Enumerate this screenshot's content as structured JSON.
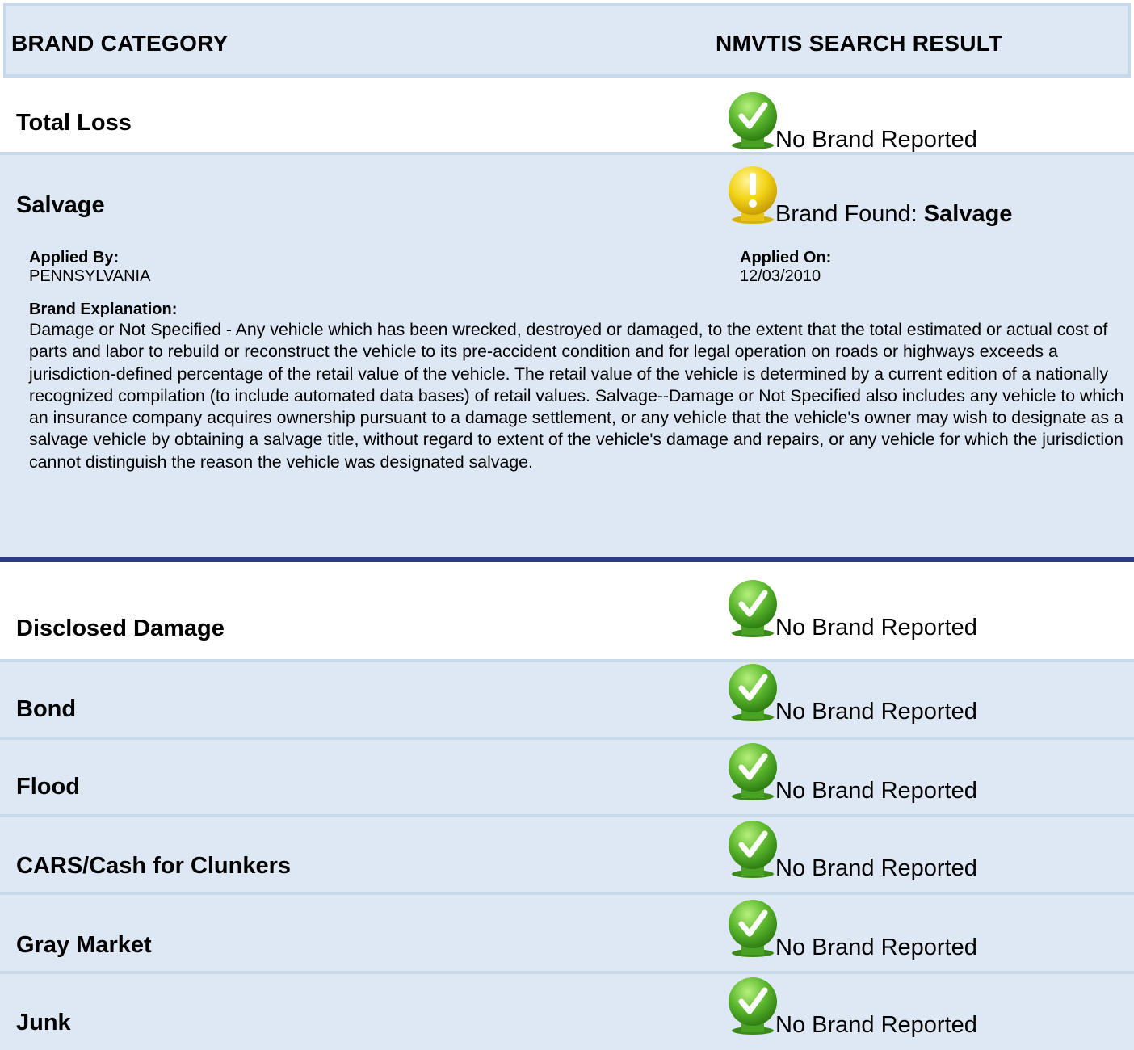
{
  "header": {
    "brand_category": "BRAND CATEGORY",
    "search_result": "NMVTIS SEARCH RESULT"
  },
  "rows": [
    {
      "category": "Total Loss",
      "status": "No Brand Reported",
      "icon": "check-icon"
    },
    {
      "category": "Salvage",
      "status_prefix": "Brand Found: ",
      "status_bold": "Salvage",
      "icon": "warning-icon"
    },
    {
      "category": "Disclosed Damage",
      "status": "No Brand Reported",
      "icon": "check-icon"
    },
    {
      "category": "Bond",
      "status": "No Brand Reported",
      "icon": "check-icon"
    },
    {
      "category": "Flood",
      "status": "No Brand Reported",
      "icon": "check-icon"
    },
    {
      "category": "CARS/Cash for Clunkers",
      "status": "No Brand Reported",
      "icon": "check-icon"
    },
    {
      "category": "Gray Market",
      "status": "No Brand Reported",
      "icon": "check-icon"
    },
    {
      "category": "Junk",
      "status": "No Brand Reported",
      "icon": "check-icon"
    }
  ],
  "salvage_details": {
    "applied_by_label": "Applied By:",
    "applied_by_value": "PENNSYLVANIA",
    "applied_on_label": "Applied On:",
    "applied_on_value": "12/03/2010",
    "explanation_label": "Brand Explanation:",
    "explanation_text": "Damage or Not Specified - Any vehicle which has been wrecked, destroyed or damaged, to the extent that the total estimated or actual cost of parts and labor to rebuild or reconstruct the vehicle to its pre-accident condition and for legal operation on roads or highways exceeds a jurisdiction-defined percentage of the retail value of the vehicle. The retail value of the vehicle is determined by a current edition of a nationally recognized compilation (to include automated data bases) of retail values. Salvage--Damage or Not Specified also includes any vehicle to which an insurance company acquires ownership pursuant to a damage settlement, or any vehicle that the vehicle's owner may wish to designate as a salvage vehicle by obtaining a salvage title, without regard to extent of the vehicle's damage and repairs, or any vehicle for which the jurisdiction cannot distinguish the reason the vehicle was designated salvage."
  },
  "colors": {
    "row_bg": "#dde8f4",
    "divider": "#2b3a8a",
    "check_green": "#5cb82e",
    "warning_yellow": "#f2d417"
  }
}
